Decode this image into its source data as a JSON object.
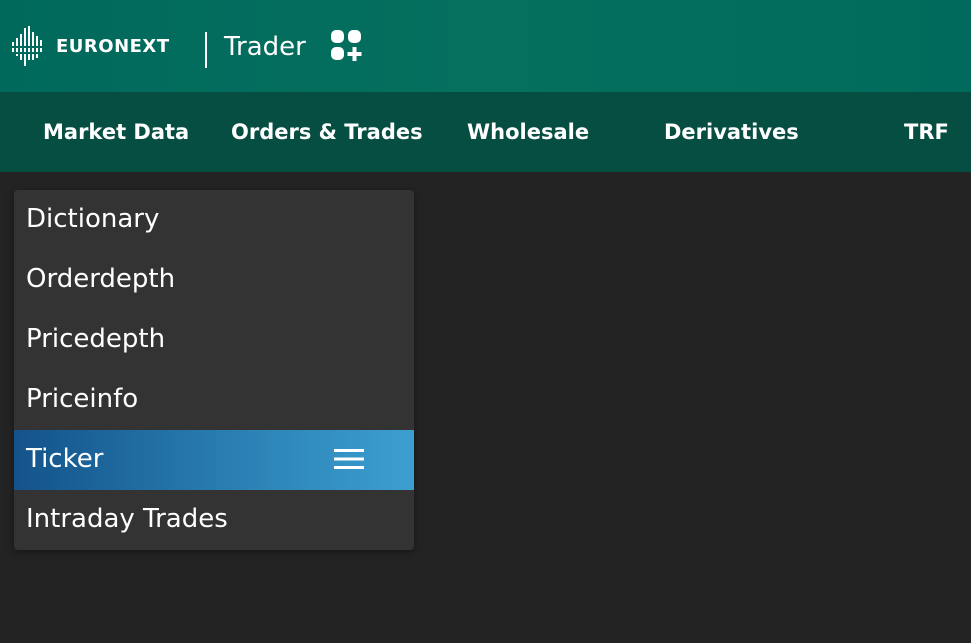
{
  "header": {
    "brand": "EURONEXT",
    "product": "Trader",
    "logo_icon": "euronext-logo-icon",
    "add_icon": "add-apps-icon",
    "background": "#006a5c"
  },
  "navbar": {
    "items": [
      {
        "label": "Market Data"
      },
      {
        "label": "Orders & Trades"
      },
      {
        "label": "Wholesale"
      },
      {
        "label": "Derivatives"
      },
      {
        "label": "TRF"
      }
    ],
    "background": "#064d42"
  },
  "menu": {
    "items": [
      {
        "label": "Dictionary",
        "active": false
      },
      {
        "label": "Orderdepth",
        "active": false
      },
      {
        "label": "Pricedepth",
        "active": false
      },
      {
        "label": "Priceinfo",
        "active": false
      },
      {
        "label": "Ticker",
        "active": true,
        "icon": "hamburger-menu-icon"
      },
      {
        "label": "Intraday Trades",
        "active": false
      }
    ],
    "background": "#333333",
    "active_color": "#2a7fb3"
  },
  "page": {
    "background": "#232323"
  }
}
